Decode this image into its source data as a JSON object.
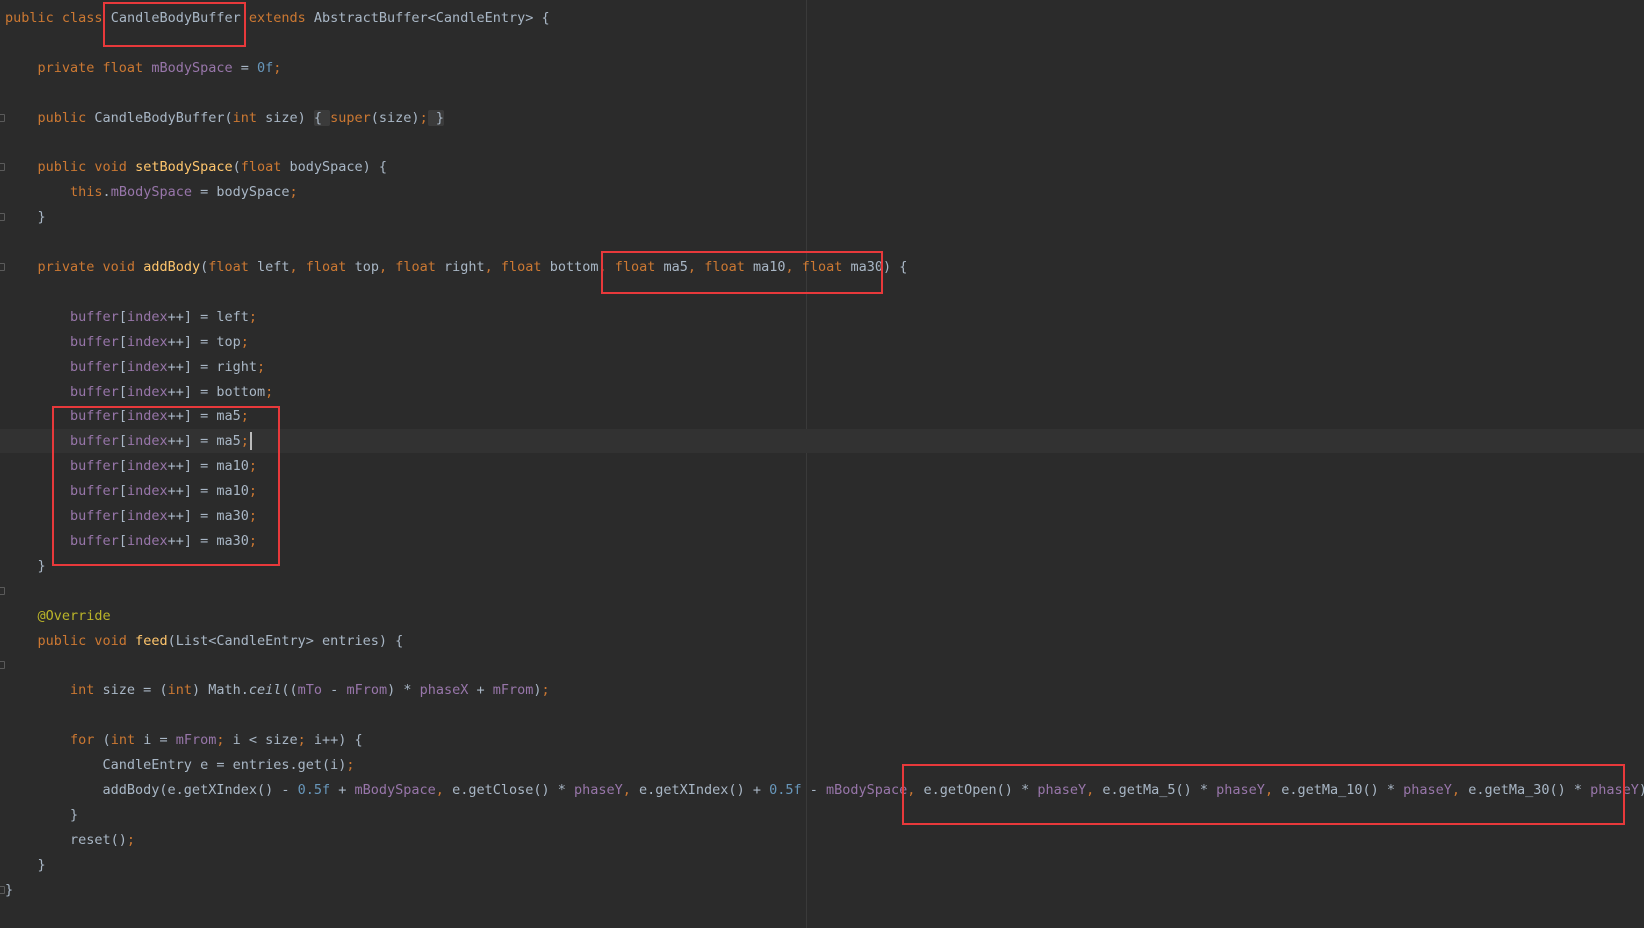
{
  "editor": {
    "language": "java",
    "lines": [
      [
        [
          "kw",
          "public "
        ],
        [
          "kw",
          "class "
        ],
        [
          "plain",
          "CandleBodyBuffer "
        ],
        [
          "kw",
          "extends "
        ],
        [
          "plain",
          "AbstractBuffer<CandleEntry> {"
        ]
      ],
      [],
      [
        [
          "plain",
          "    "
        ],
        [
          "kw",
          "private "
        ],
        [
          "kw",
          "float "
        ],
        [
          "field",
          "mBodySpace"
        ],
        [
          "plain",
          " = "
        ],
        [
          "num",
          "0f"
        ],
        [
          "kw",
          ";"
        ]
      ],
      [],
      [
        [
          "plain",
          "    "
        ],
        [
          "kw",
          "public "
        ],
        [
          "plain",
          "CandleBodyBuffer("
        ],
        [
          "kw",
          "int "
        ],
        [
          "plain",
          "size) "
        ],
        [
          "fold",
          "{ "
        ],
        [
          "kw",
          "super"
        ],
        [
          "plain",
          "(size)"
        ],
        [
          "kw",
          ";"
        ],
        [
          "fold",
          " }"
        ]
      ],
      [],
      [
        [
          "plain",
          "    "
        ],
        [
          "kw",
          "public "
        ],
        [
          "kw",
          "void "
        ],
        [
          "fn",
          "setBodySpace"
        ],
        [
          "plain",
          "("
        ],
        [
          "kw",
          "float "
        ],
        [
          "plain",
          "bodySpace) {"
        ]
      ],
      [
        [
          "plain",
          "        "
        ],
        [
          "kw",
          "this"
        ],
        [
          "plain",
          "."
        ],
        [
          "field",
          "mBodySpace"
        ],
        [
          "plain",
          " = bodySpace"
        ],
        [
          "kw",
          ";"
        ]
      ],
      [
        [
          "plain",
          "    }"
        ]
      ],
      [],
      [
        [
          "plain",
          "    "
        ],
        [
          "kw",
          "private "
        ],
        [
          "kw",
          "void "
        ],
        [
          "fn",
          "addBody"
        ],
        [
          "plain",
          "("
        ],
        [
          "kw",
          "float "
        ],
        [
          "plain",
          "left"
        ],
        [
          "kw",
          ", "
        ],
        [
          "kw",
          "float "
        ],
        [
          "plain",
          "top"
        ],
        [
          "kw",
          ", "
        ],
        [
          "kw",
          "float "
        ],
        [
          "plain",
          "right"
        ],
        [
          "kw",
          ", "
        ],
        [
          "kw",
          "float "
        ],
        [
          "plain",
          "bottom"
        ],
        [
          "kw",
          ", "
        ],
        [
          "kw",
          "float "
        ],
        [
          "plain",
          "ma5"
        ],
        [
          "kw",
          ", "
        ],
        [
          "kw",
          "float "
        ],
        [
          "plain",
          "ma10"
        ],
        [
          "kw",
          ", "
        ],
        [
          "kw",
          "float "
        ],
        [
          "plain",
          "ma30) {"
        ]
      ],
      [],
      [
        [
          "plain",
          "        "
        ],
        [
          "field",
          "buffer"
        ],
        [
          "plain",
          "["
        ],
        [
          "field",
          "index"
        ],
        [
          "plain",
          "++] = left"
        ],
        [
          "kw",
          ";"
        ]
      ],
      [
        [
          "plain",
          "        "
        ],
        [
          "field",
          "buffer"
        ],
        [
          "plain",
          "["
        ],
        [
          "field",
          "index"
        ],
        [
          "plain",
          "++] = top"
        ],
        [
          "kw",
          ";"
        ]
      ],
      [
        [
          "plain",
          "        "
        ],
        [
          "field",
          "buffer"
        ],
        [
          "plain",
          "["
        ],
        [
          "field",
          "index"
        ],
        [
          "plain",
          "++] = right"
        ],
        [
          "kw",
          ";"
        ]
      ],
      [
        [
          "plain",
          "        "
        ],
        [
          "field",
          "buffer"
        ],
        [
          "plain",
          "["
        ],
        [
          "field",
          "index"
        ],
        [
          "plain",
          "++] = bottom"
        ],
        [
          "kw",
          ";"
        ]
      ],
      [
        [
          "plain",
          "        "
        ],
        [
          "field",
          "buffer"
        ],
        [
          "plain",
          "["
        ],
        [
          "field",
          "index"
        ],
        [
          "plain",
          "++] = ma5"
        ],
        [
          "kw",
          ";"
        ]
      ],
      [
        [
          "plain",
          "        "
        ],
        [
          "field",
          "buffer"
        ],
        [
          "plain",
          "["
        ],
        [
          "field",
          "index"
        ],
        [
          "plain",
          "++] = ma5"
        ],
        [
          "kw",
          ";"
        ]
      ],
      [
        [
          "plain",
          "        "
        ],
        [
          "field",
          "buffer"
        ],
        [
          "plain",
          "["
        ],
        [
          "field",
          "index"
        ],
        [
          "plain",
          "++] = ma10"
        ],
        [
          "kw",
          ";"
        ]
      ],
      [
        [
          "plain",
          "        "
        ],
        [
          "field",
          "buffer"
        ],
        [
          "plain",
          "["
        ],
        [
          "field",
          "index"
        ],
        [
          "plain",
          "++] = ma10"
        ],
        [
          "kw",
          ";"
        ]
      ],
      [
        [
          "plain",
          "        "
        ],
        [
          "field",
          "buffer"
        ],
        [
          "plain",
          "["
        ],
        [
          "field",
          "index"
        ],
        [
          "plain",
          "++] = ma30"
        ],
        [
          "kw",
          ";"
        ]
      ],
      [
        [
          "plain",
          "        "
        ],
        [
          "field",
          "buffer"
        ],
        [
          "plain",
          "["
        ],
        [
          "field",
          "index"
        ],
        [
          "plain",
          "++] = ma30"
        ],
        [
          "kw",
          ";"
        ]
      ],
      [
        [
          "plain",
          "    }"
        ]
      ],
      [],
      [
        [
          "plain",
          "    "
        ],
        [
          "ann",
          "@Override"
        ]
      ],
      [
        [
          "plain",
          "    "
        ],
        [
          "kw",
          "public "
        ],
        [
          "kw",
          "void "
        ],
        [
          "fn",
          "feed"
        ],
        [
          "plain",
          "(List<CandleEntry> entries) {"
        ]
      ],
      [],
      [
        [
          "plain",
          "        "
        ],
        [
          "kw",
          "int "
        ],
        [
          "plain",
          "size = ("
        ],
        [
          "kw",
          "int"
        ],
        [
          "plain",
          ") Math."
        ],
        [
          "static",
          "ceil"
        ],
        [
          "plain",
          "(("
        ],
        [
          "field",
          "mTo"
        ],
        [
          "plain",
          " - "
        ],
        [
          "field",
          "mFrom"
        ],
        [
          "plain",
          ") * "
        ],
        [
          "field",
          "phaseX"
        ],
        [
          "plain",
          " + "
        ],
        [
          "field",
          "mFrom"
        ],
        [
          "plain",
          ")"
        ],
        [
          "kw",
          ";"
        ]
      ],
      [],
      [
        [
          "plain",
          "        "
        ],
        [
          "kw",
          "for "
        ],
        [
          "plain",
          "("
        ],
        [
          "kw",
          "int "
        ],
        [
          "plain",
          "i = "
        ],
        [
          "field",
          "mFrom"
        ],
        [
          "kw",
          "; "
        ],
        [
          "plain",
          "i < size"
        ],
        [
          "kw",
          "; "
        ],
        [
          "plain",
          "i++) {"
        ]
      ],
      [
        [
          "plain",
          "            CandleEntry e = entries.get(i)"
        ],
        [
          "kw",
          ";"
        ]
      ],
      [
        [
          "plain",
          "            addBody(e.getXIndex() - "
        ],
        [
          "num",
          "0.5f"
        ],
        [
          "plain",
          " + "
        ],
        [
          "field",
          "mBodySpace"
        ],
        [
          "kw",
          ", "
        ],
        [
          "plain",
          "e.getClose() * "
        ],
        [
          "field",
          "phaseY"
        ],
        [
          "kw",
          ", "
        ],
        [
          "plain",
          "e.getXIndex() + "
        ],
        [
          "num",
          "0.5f"
        ],
        [
          "plain",
          " - "
        ],
        [
          "field",
          "mBodySpace"
        ],
        [
          "kw",
          ", "
        ],
        [
          "plain",
          "e.getOpen() * "
        ],
        [
          "field",
          "phaseY"
        ],
        [
          "kw",
          ", "
        ],
        [
          "plain",
          "e.getMa_5() * "
        ],
        [
          "field",
          "phaseY"
        ],
        [
          "kw",
          ", "
        ],
        [
          "plain",
          "e.getMa_10() * "
        ],
        [
          "field",
          "phaseY"
        ],
        [
          "kw",
          ", "
        ],
        [
          "plain",
          "e.getMa_30() * "
        ],
        [
          "field",
          "phaseY"
        ],
        [
          "plain",
          ")"
        ],
        [
          "kw",
          ";"
        ]
      ],
      [
        [
          "plain",
          "        }"
        ]
      ],
      [
        [
          "plain",
          "        reset()"
        ],
        [
          "kw",
          ";"
        ]
      ],
      [
        [
          "plain",
          "    }"
        ]
      ],
      [
        [
          "plain",
          "}"
        ]
      ]
    ]
  }
}
